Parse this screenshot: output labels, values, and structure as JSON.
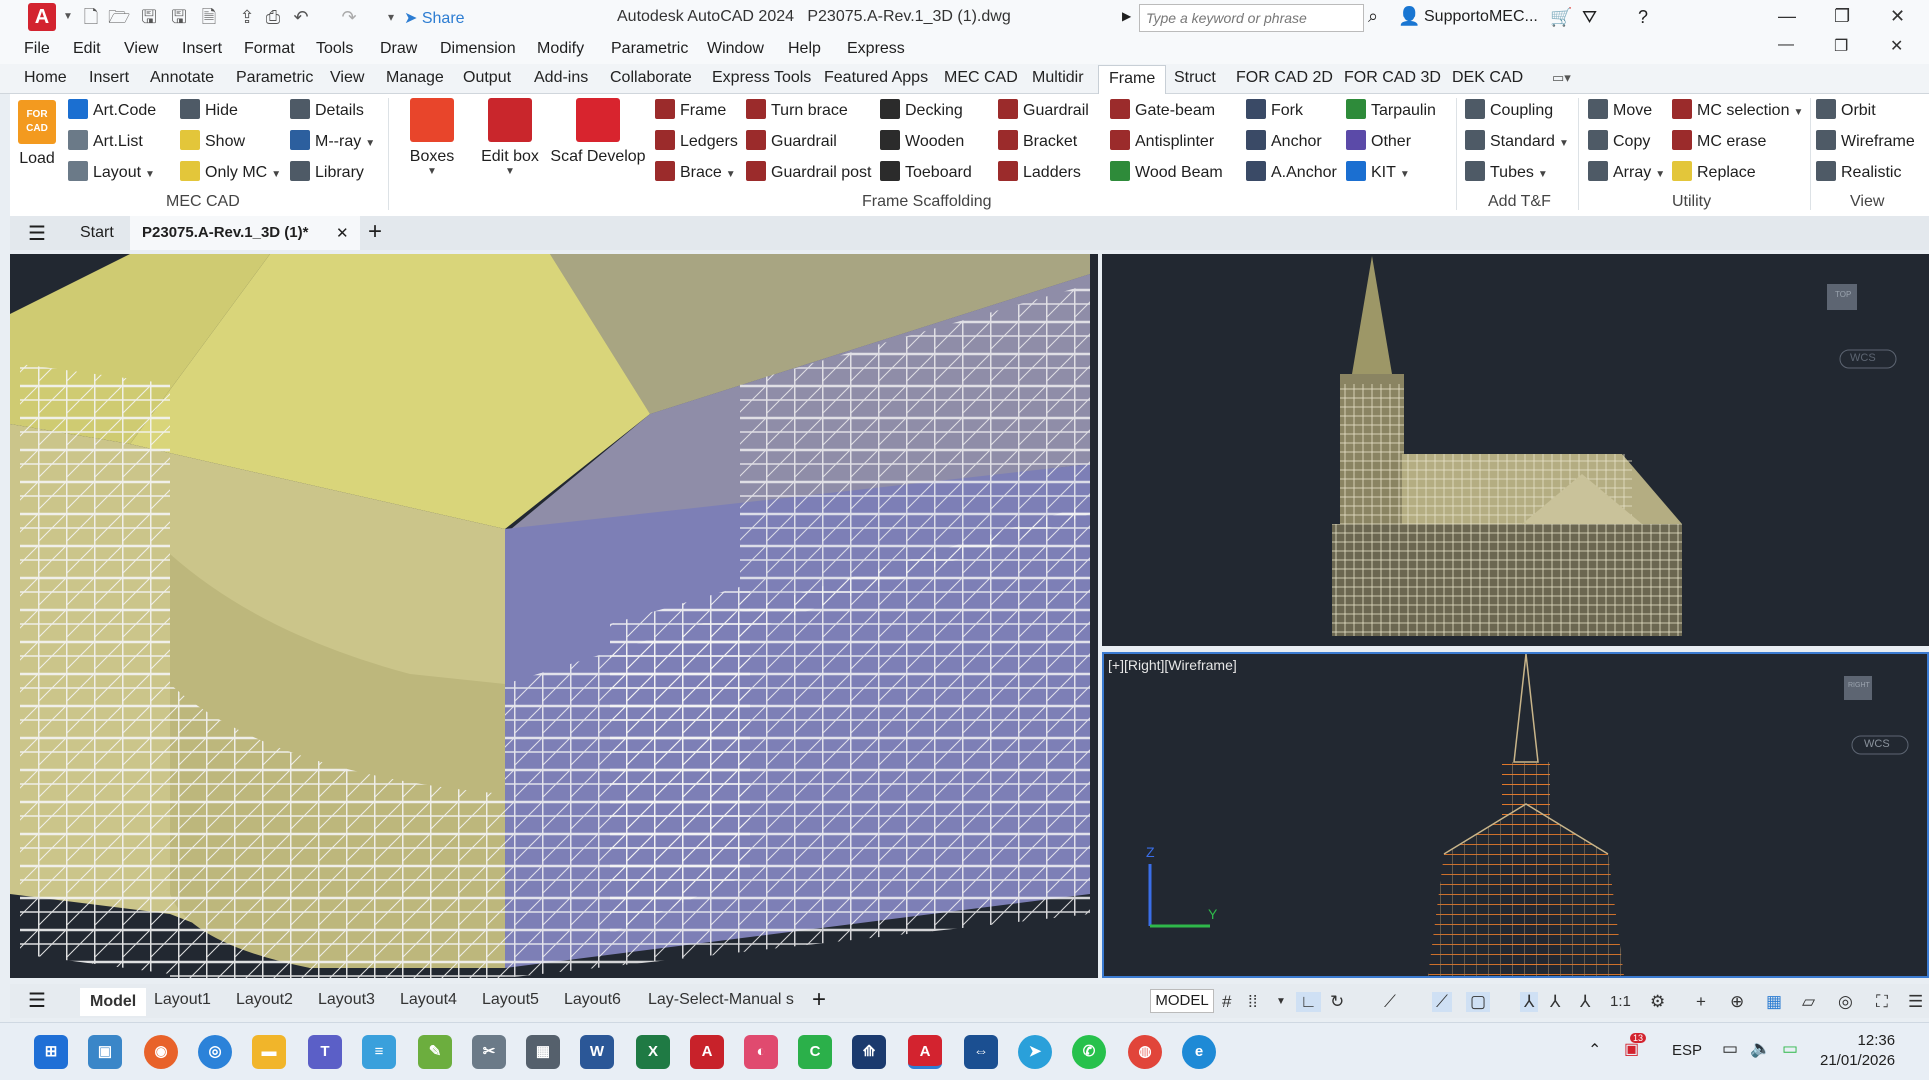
{
  "app": {
    "title": "Autodesk AutoCAD 2024",
    "filename": "P23075.A-Rev.1_3D (1).dwg",
    "logo": "A"
  },
  "titlebar": {
    "share_label": "Share",
    "search_placeholder": "Type a keyword or phrase",
    "user": "SupportoMEC..."
  },
  "menu": [
    "File",
    "Edit",
    "View",
    "Insert",
    "Format",
    "Tools",
    "Draw",
    "Dimension",
    "Modify",
    "Parametric",
    "Window",
    "Help",
    "Express"
  ],
  "ribbon_tabs": [
    "Home",
    "Insert",
    "Annotate",
    "Parametric",
    "View",
    "Manage",
    "Output",
    "Add-ins",
    "Collaborate",
    "Express Tools",
    "Featured Apps",
    "MEC CAD",
    "Multidir",
    "Frame",
    "Struct",
    "FOR CAD 2D",
    "FOR CAD 3D",
    "DEK CAD"
  ],
  "active_tab": "Frame",
  "ribbon": {
    "load_label": "Load",
    "load_logo": "FOR CAD",
    "mec": {
      "artcode": "Art.Code",
      "artlist": "Art.List",
      "layout": "Layout",
      "hide": "Hide",
      "show": "Show",
      "onlymc": "Only MC",
      "details": "Details",
      "mray": "M--ray",
      "library": "Library",
      "group": "MEC CAD"
    },
    "boxes": "Boxes",
    "editbox": "Edit box",
    "scafdev": "Scaf Develop",
    "frame": {
      "frame": "Frame",
      "ledgers": "Ledgers",
      "brace": "Brace",
      "turnbrace": "Turn brace",
      "guardrail": "Guardrail",
      "guardrailpost": "Guardrail post",
      "decking": "Decking",
      "wooden": "Wooden",
      "toeboard": "Toeboard",
      "guardrail2": "Guardrail",
      "bracket": "Bracket",
      "ladders": "Ladders",
      "gatebeam": "Gate-beam",
      "antisplinter": "Antisplinter",
      "woodbeam": "Wood Beam",
      "fork": "Fork",
      "anchor": "Anchor",
      "aanchor": "A.Anchor",
      "tarpaulin": "Tarpaulin",
      "other": "Other",
      "kit": "KIT",
      "group": "Frame Scaffolding"
    },
    "addtf": {
      "coupling": "Coupling",
      "standard": "Standard",
      "tubes": "Tubes",
      "group": "Add T&F"
    },
    "utility": {
      "move": "Move",
      "copy": "Copy",
      "array": "Array",
      "mcsel": "MC selection",
      "mcerase": "MC erase",
      "replace": "Replace",
      "group": "Utility"
    },
    "view": {
      "orbit": "Orbit",
      "wireframe": "Wireframe",
      "realistic": "Realistic",
      "group": "View"
    }
  },
  "doc_tabs": {
    "start": "Start",
    "current": "P23075.A-Rev.1_3D (1)*"
  },
  "viewports": {
    "br_label": "[+][Right][Wireframe]",
    "wcs": "WCS",
    "top_cube": "TOP",
    "right_cube": "RIGHT",
    "axis_z": "Z",
    "axis_y": "Y"
  },
  "layout_tabs": [
    "Model",
    "Layout1",
    "Layout2",
    "Layout3",
    "Layout4",
    "Layout5",
    "Layout6",
    "Lay-Select-Manual s"
  ],
  "status": {
    "model": "MODEL",
    "scale": "1:1"
  },
  "taskbar": {
    "lang": "ESP",
    "time": "12:36",
    "date": "21/01/2026",
    "badge": "13"
  },
  "colors": {
    "accent": "#3b7bd1",
    "roof": "#d9d57a",
    "wall": "#7d7fb6",
    "canvas": "#222831"
  }
}
